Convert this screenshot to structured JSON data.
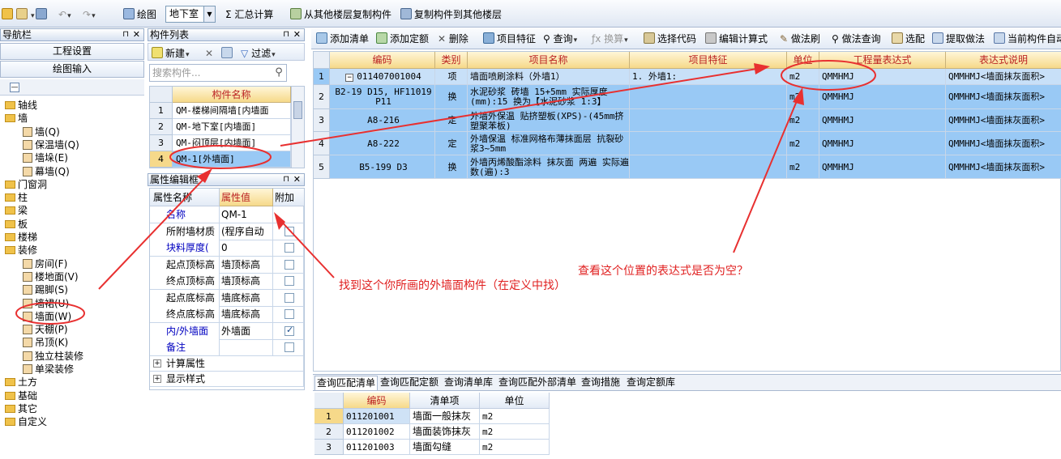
{
  "top_toolbar": {
    "draw_label": "绘图",
    "floor_value": "地下室",
    "sum_calc": "Σ 汇总计算",
    "copy_from": "从其他楼层复制构件",
    "copy_to": "复制构件到其他楼层"
  },
  "nav": {
    "title": "导航栏",
    "project_settings": "工程设置",
    "drawing_input": "绘图输入",
    "tree": [
      {
        "label": "轴线",
        "type": "folder"
      },
      {
        "label": "墙",
        "type": "folder"
      },
      {
        "label": "墙(Q)",
        "type": "leaf"
      },
      {
        "label": "保温墙(Q)",
        "type": "leaf"
      },
      {
        "label": "墙垛(E)",
        "type": "leaf"
      },
      {
        "label": "幕墙(Q)",
        "type": "leaf"
      },
      {
        "label": "门窗洞",
        "type": "folder"
      },
      {
        "label": "柱",
        "type": "folder"
      },
      {
        "label": "梁",
        "type": "folder"
      },
      {
        "label": "板",
        "type": "folder"
      },
      {
        "label": "楼梯",
        "type": "folder"
      },
      {
        "label": "装修",
        "type": "folder"
      },
      {
        "label": "房间(F)",
        "type": "leaf"
      },
      {
        "label": "楼地面(V)",
        "type": "leaf"
      },
      {
        "label": "踢脚(S)",
        "type": "leaf"
      },
      {
        "label": "墙裙(U)",
        "type": "leaf"
      },
      {
        "label": "墙面(W)",
        "type": "leaf"
      },
      {
        "label": "天棚(P)",
        "type": "leaf"
      },
      {
        "label": "吊顶(K)",
        "type": "leaf"
      },
      {
        "label": "独立柱装修",
        "type": "leaf"
      },
      {
        "label": "单梁装修",
        "type": "leaf"
      },
      {
        "label": "土方",
        "type": "folder"
      },
      {
        "label": "基础",
        "type": "folder"
      },
      {
        "label": "其它",
        "type": "folder"
      },
      {
        "label": "自定义",
        "type": "folder"
      }
    ]
  },
  "component_list": {
    "title": "构件列表",
    "new_label": "新建",
    "filter_label": "过滤",
    "search_placeholder": "搜索构件...",
    "col_name": "构件名称",
    "rows": [
      {
        "no": "1",
        "name": "QM-楼梯间隔墙[内墙面"
      },
      {
        "no": "2",
        "name": "QM-地下室[内墙面]"
      },
      {
        "no": "3",
        "name": "QM-闷顶层[内墙面]"
      },
      {
        "no": "4",
        "name": "QM-1[外墙面]"
      }
    ]
  },
  "property_editor": {
    "title": "属性编辑框",
    "col_name": "属性名称",
    "col_value": "属性值",
    "col_extra": "附加",
    "rows": [
      {
        "name": "名称",
        "value": "QM-1",
        "blue": true,
        "check": false,
        "has_check": false
      },
      {
        "name": "所附墙材质",
        "value": "(程序自动",
        "blue": false,
        "check": false,
        "has_check": true
      },
      {
        "name": "块料厚度(",
        "value": "0",
        "blue": true,
        "check": false,
        "has_check": true
      },
      {
        "name": "起点顶标高",
        "value": "墙顶标高",
        "blue": false,
        "check": false,
        "has_check": true
      },
      {
        "name": "终点顶标高",
        "value": "墙顶标高",
        "blue": false,
        "check": false,
        "has_check": true
      },
      {
        "name": "起点底标高",
        "value": "墙底标高",
        "blue": false,
        "check": false,
        "has_check": true
      },
      {
        "name": "终点底标高",
        "value": "墙底标高",
        "blue": false,
        "check": false,
        "has_check": true
      },
      {
        "name": "内/外墙面",
        "value": "外墙面",
        "blue": true,
        "check": true,
        "has_check": true
      },
      {
        "name": "备注",
        "value": "",
        "blue": true,
        "check": false,
        "has_check": true
      }
    ],
    "groups": [
      "计算属性",
      "显示样式"
    ]
  },
  "main_toolbar": {
    "add_list": "添加清单",
    "add_quota": "添加定额",
    "delete": "删除",
    "project_feature": "项目特征",
    "query": "查询",
    "convert": "换算",
    "select_code": "选择代码",
    "edit_formula": "编辑计算式",
    "method_brush": "做法刷",
    "method_query": "做法查询",
    "select_ref": "选配",
    "extract_method": "提取做法",
    "current_auto": "当前构件自动"
  },
  "main_grid": {
    "headers": [
      "编码",
      "类别",
      "项目名称",
      "项目特征",
      "单位",
      "工程量表达式",
      "表达式说明"
    ],
    "rows": [
      {
        "no": "1",
        "code": "011407001004",
        "type": "项",
        "name": "墙面喷刷涂料（外墙1）",
        "feature": "1. 外墙1:",
        "unit": "m2",
        "expr": "QMMHMJ",
        "desc": "QMMHMJ<墙面抹灰面积>"
      },
      {
        "no": "2",
        "code": "B2-19 D15, HF11019 P11",
        "type": "换",
        "name": "水泥砂浆 砖墙 15+5mm 实际厚度(mm):15 换为【水泥砂浆 1:3】",
        "feature": "",
        "unit": "m2",
        "expr": "QMMHMJ",
        "desc": "QMMHMJ<墙面抹灰面积>"
      },
      {
        "no": "3",
        "code": "A8-216",
        "type": "定",
        "name": "外墙外保温 贴挤塑板(XPS)-(45mm挤塑聚苯板)",
        "feature": "",
        "unit": "m2",
        "expr": "QMMHMJ",
        "desc": "QMMHMJ<墙面抹灰面积>"
      },
      {
        "no": "4",
        "code": "A8-222",
        "type": "定",
        "name": "外墙保温 标准网格布薄抹面层 抗裂砂浆3~5mm",
        "feature": "",
        "unit": "m2",
        "expr": "QMMHMJ",
        "desc": "QMMHMJ<墙面抹灰面积>"
      },
      {
        "no": "5",
        "code": "B5-199 D3",
        "type": "换",
        "name": "外墙丙烯酸酯涂料 抹灰面 两遍 实际遍数(遍):3",
        "feature": "",
        "unit": "m2",
        "expr": "QMMHMJ",
        "desc": "QMMHMJ<墙面抹灰面积>"
      }
    ]
  },
  "bottom_tabs": [
    "查询匹配清单",
    "查询匹配定额",
    "查询清单库",
    "查询匹配外部清单",
    "查询措施",
    "查询定额库"
  ],
  "bottom_grid": {
    "headers": [
      "编码",
      "清单项",
      "单位"
    ],
    "rows": [
      {
        "no": "1",
        "code": "011201001",
        "item": "墙面一般抹灰",
        "unit": "m2"
      },
      {
        "no": "2",
        "code": "011201002",
        "item": "墙面装饰抹灰",
        "unit": "m2"
      },
      {
        "no": "3",
        "code": "011201003",
        "item": "墙面勾缝",
        "unit": "m2"
      }
    ]
  },
  "annotations": {
    "find_component": "找到这个你所画的外墙面构件（在定义中找）",
    "check_expression": "查看这个位置的表达式是否为空？"
  },
  "colors": {
    "accent_red": "#e02020",
    "row_selected": "#99c9f5",
    "header_gold": "#f6d98a"
  }
}
